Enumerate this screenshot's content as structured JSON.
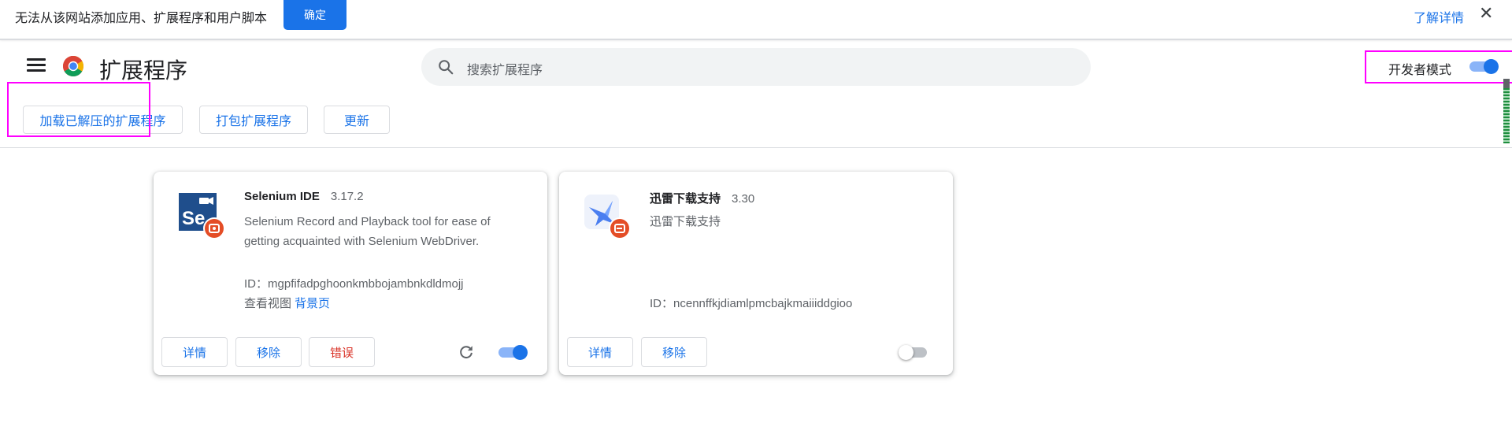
{
  "infobar": {
    "message": "无法从该网站添加应用、扩展程序和用户脚本",
    "ok_label": "确定",
    "learn_more": "了解详情",
    "close_glyph": "✕"
  },
  "header": {
    "title": "扩展程序",
    "search_placeholder": "搜索扩展程序",
    "developer_mode_label": "开发者模式",
    "developer_mode_on": true
  },
  "toolbar": {
    "load_unpacked": "加载已解压的扩展程序",
    "pack_extension": "打包扩展程序",
    "update": "更新"
  },
  "extensions": [
    {
      "name": "Selenium IDE",
      "version": "3.17.2",
      "description": "Selenium Record and Playback tool for ease of getting acquainted with Selenium WebDriver.",
      "id_label": "ID：",
      "id": "mgpfifadpghoonkmbbojambnkdldmojj",
      "views_label": "查看视图",
      "views_link": "背景页",
      "details_label": "详情",
      "remove_label": "移除",
      "errors_label": "错误",
      "enabled": true,
      "icon": "selenium-ide-icon"
    },
    {
      "name": "迅雷下载支持",
      "version": "3.30",
      "description": "迅雷下载支持",
      "id_label": "ID：",
      "id": "ncennffkjdiamlpmcbajkmaiiiddgioo",
      "details_label": "详情",
      "remove_label": "移除",
      "enabled": false,
      "icon": "thunder-download-icon"
    }
  ],
  "colors": {
    "accent": "#1a73e8",
    "error": "#d93025",
    "annotation": "#ff00ff"
  }
}
